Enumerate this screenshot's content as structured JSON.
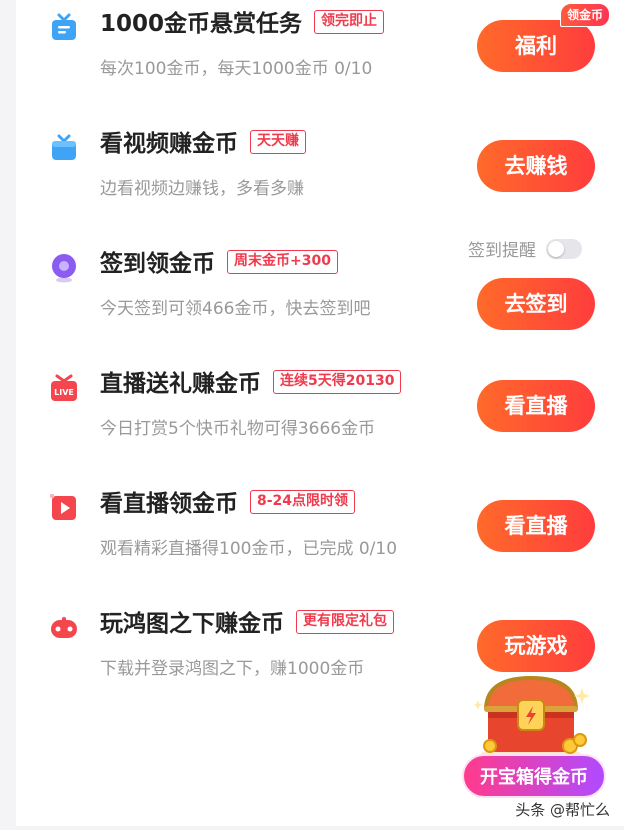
{
  "tasks": [
    {
      "title": "1000金币悬赏任务",
      "badge": "领完即止",
      "desc": "每次100金币，每天1000金币 0/10",
      "button": "福利",
      "icon": "gift-tv-icon"
    },
    {
      "title": "看视频赚金币",
      "badge": "天天赚",
      "desc": "边看视频边赚钱，多看多赚",
      "button": "去赚钱",
      "icon": "tv-icon"
    },
    {
      "title": "签到领金币",
      "badge": "周末金币+300",
      "desc": "今天签到可领466金币，快去签到吧",
      "button": "去签到",
      "icon": "location-pin-icon"
    },
    {
      "title": "直播送礼赚金币",
      "badge": "连续5天得20130",
      "desc": "今日打赏5个快币礼物可得3666金币",
      "button": "看直播",
      "icon": "live-gift-icon"
    },
    {
      "title": "看直播领金币",
      "badge": "8-24点限时领",
      "desc": "观看精彩直播得100金币，已完成 0/10",
      "button": "看直播",
      "icon": "play-icon"
    },
    {
      "title": "玩鸿图之下赚金币",
      "badge": "更有限定礼包",
      "desc": "下载并登录鸿图之下，赚1000金币",
      "button": "玩游戏",
      "icon": "gamepad-icon"
    }
  ],
  "coin_tag": "领金币",
  "reminder": {
    "label": "签到提醒",
    "on": false
  },
  "treasure": {
    "label": "开宝箱得金币"
  },
  "watermark": "头条 @帮忙么"
}
